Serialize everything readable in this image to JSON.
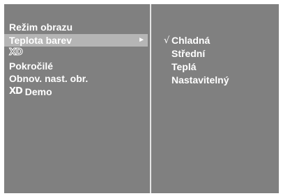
{
  "left_menu": {
    "items": [
      {
        "label": "Režim obrazu"
      },
      {
        "label": "Teplota barev",
        "arrow": "►",
        "selected": true
      },
      {
        "logo": "XD"
      },
      {
        "label": "Pokročilé"
      },
      {
        "label": "Obnov. nast. obr."
      },
      {
        "logo": "XD",
        "label": "Demo"
      }
    ]
  },
  "right_menu": {
    "check_mark": "√",
    "items": [
      {
        "label": "Chladná",
        "checked": true
      },
      {
        "label": "Střední"
      },
      {
        "label": "Teplá"
      },
      {
        "label": "Nastavitelný"
      }
    ]
  },
  "colors": {
    "background": "#808080",
    "highlight": "#b5b5b5",
    "text": "#ffffff",
    "divider": "#e4e4e4"
  }
}
